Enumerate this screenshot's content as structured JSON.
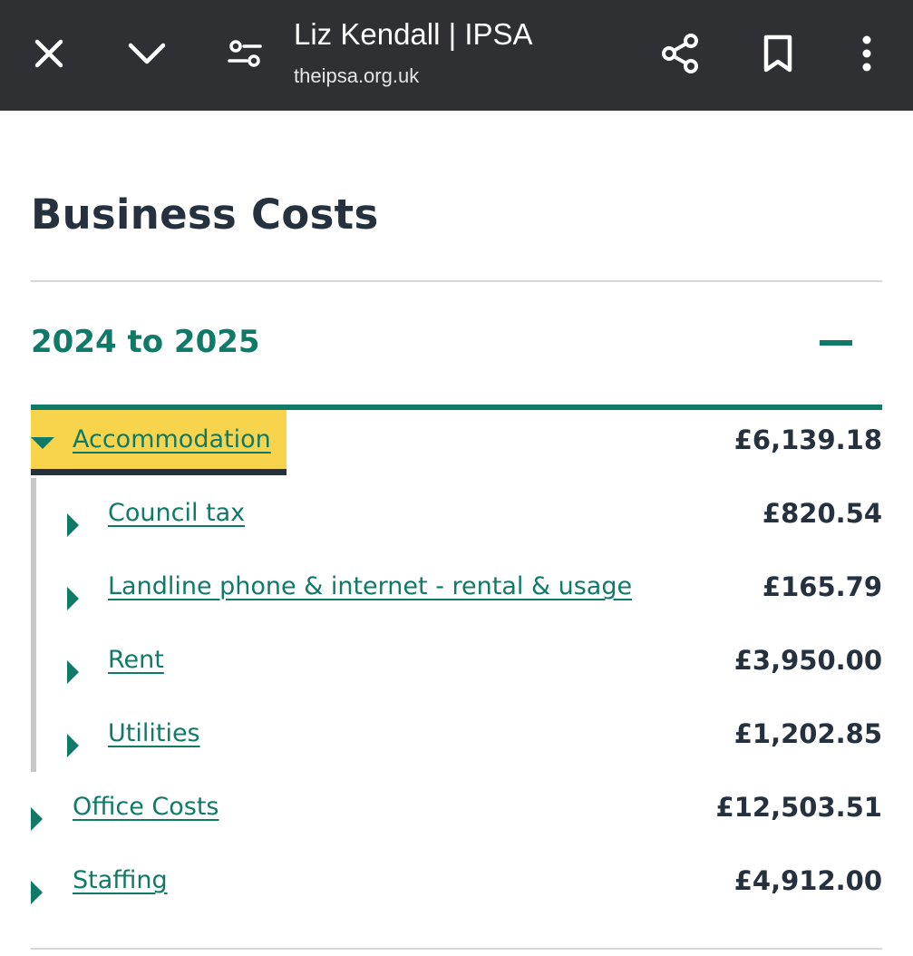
{
  "browser": {
    "title": "Liz Kendall | IPSA",
    "url": "theipsa.org.uk",
    "icons": {
      "close": "close-icon",
      "minimize": "chevron-down-icon",
      "page_settings": "tune-icon",
      "share": "share-icon",
      "bookmark": "bookmark-icon",
      "more": "more-vert-icon"
    }
  },
  "page": {
    "title": "Business Costs",
    "year_section": {
      "heading": "2024 to 2025",
      "expanded": true
    },
    "categories": [
      {
        "label": "Accommodation",
        "amount": "£6,139.18",
        "expanded": true,
        "children": [
          {
            "label": "Council tax",
            "amount": "£820.54"
          },
          {
            "label": "Landline phone & internet - rental & usage",
            "amount": "£165.79"
          },
          {
            "label": "Rent",
            "amount": "£3,950.00"
          },
          {
            "label": "Utilities",
            "amount": "£1,202.85"
          }
        ]
      },
      {
        "label": "Office Costs",
        "amount": "£12,503.51",
        "expanded": false
      },
      {
        "label": "Staffing",
        "amount": "£4,912.00",
        "expanded": false
      }
    ]
  },
  "colors": {
    "topbar_bg": "#2f3033",
    "accent_green": "#0e7a67",
    "text_dark": "#25313f",
    "focus_yellow": "#f7d44c",
    "divider_grey": "#d4d7da"
  }
}
